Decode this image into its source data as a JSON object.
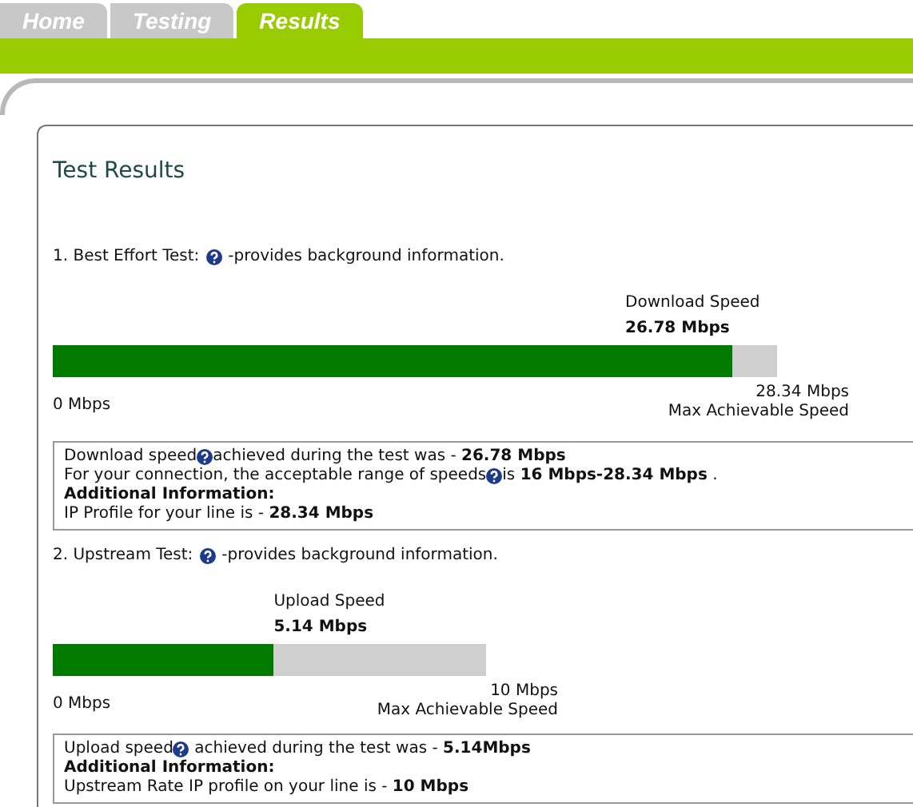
{
  "tabs": [
    {
      "label": "Home",
      "selected": false
    },
    {
      "label": "Testing",
      "selected": false
    },
    {
      "label": "Results",
      "selected": true
    }
  ],
  "panel": {
    "title": "Test Results"
  },
  "tests": [
    {
      "heading": "1. Best Effort Test:",
      "note": "-provides background information.",
      "speed_label": "Download Speed",
      "speed_value": "26.78 Mbps",
      "level": 0.938,
      "min_label": "0 Mbps",
      "max_value": "28.34 Mbps",
      "max_label": "Max Achievable Speed",
      "info": [
        {
          "text": "Download speed",
          "help": true,
          "after": "achieved during the test was - **26.78 Mbps**"
        },
        {
          "text": "For your connection, the acceptable range of speeds",
          "help": true,
          "after": "is **16 Mbps-28.34 Mbps** ."
        },
        {
          "text": "**Additional Information:**",
          "help": false
        },
        {
          "text": "IP Profile for your line is - **28.34 Mbps**",
          "help": false
        }
      ]
    },
    {
      "heading": "2. Upstream Test:",
      "note": "-provides background information.",
      "speed_label": "Upload Speed",
      "speed_value": "5.14 Mbps",
      "level": 0.51,
      "min_label": "0 Mbps",
      "max_value": "10 Mbps",
      "max_label": "Max Achievable Speed",
      "info": [
        {
          "text": "Upload speed",
          "help": true,
          "after": " achieved during the test was - **5.14Mbps**"
        },
        {
          "text": "**Additional Information:**",
          "help": false
        },
        {
          "text": "Upstream Rate IP profile on your line is - **10 Mbps**",
          "help": false
        }
      ]
    }
  ]
}
